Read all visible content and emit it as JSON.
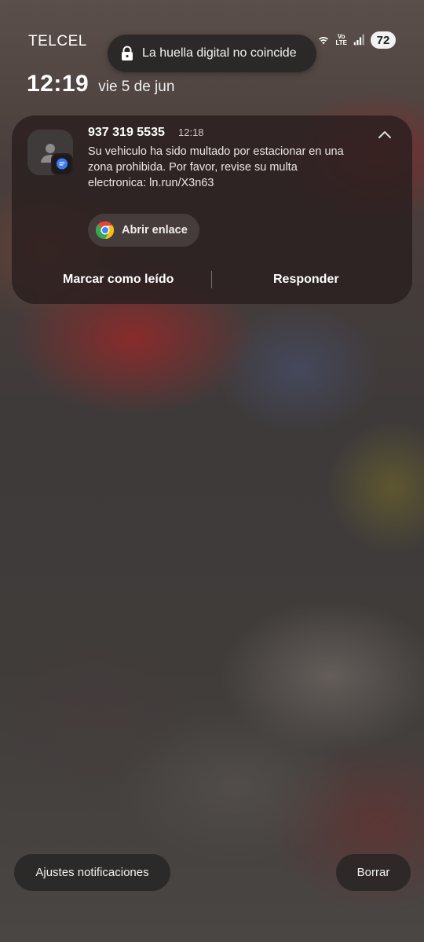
{
  "status_bar": {
    "carrier": "TELCEL",
    "volte_top": "Vo",
    "volte_bottom": "LTE",
    "battery": "72"
  },
  "toast": {
    "text": "La huella digital no coincide",
    "icon": "lock-icon"
  },
  "lockscreen": {
    "time": "12:19",
    "date": "vie 5 de jun"
  },
  "notification": {
    "sender": "937 319 5535",
    "time": "12:18",
    "message": "Su vehiculo ha sido multado por estacionar en una zona prohibida. Por favor, revise su multa electronica: ln.run/X3n63",
    "open_link_label": "Abrir enlace",
    "actions": {
      "mark_read": "Marcar como leído",
      "reply": "Responder"
    }
  },
  "bottom": {
    "settings": "Ajustes notificaciones",
    "clear": "Borrar"
  },
  "colors": {
    "card_bg": "#2a1e1e",
    "badge_blue": "#3d7bf5"
  }
}
